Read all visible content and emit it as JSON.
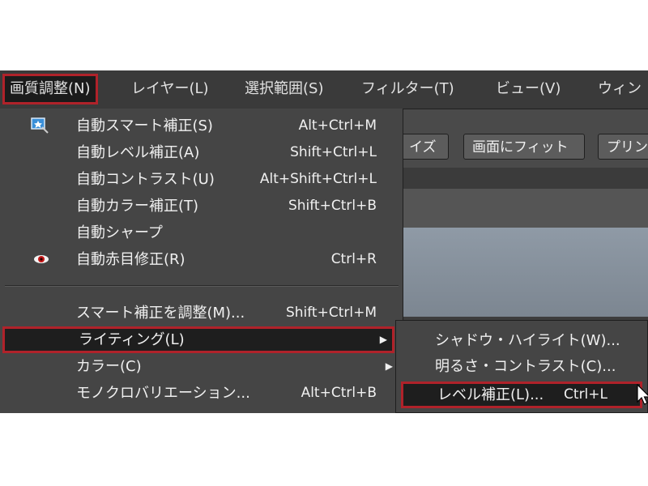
{
  "menubar": {
    "items": [
      {
        "label": "画質調整(N)"
      },
      {
        "label": "レイヤー(L)"
      },
      {
        "label": "選択範囲(S)"
      },
      {
        "label": "フィルター(T)"
      },
      {
        "label": "ビュー(V)"
      },
      {
        "label": "ウィン"
      }
    ]
  },
  "toolbar": {
    "buttons": [
      {
        "label": "イズ"
      },
      {
        "label": "画面にフィット"
      },
      {
        "label": "プリン"
      }
    ]
  },
  "dropdown": {
    "items": [
      {
        "label": "自動スマート補正(S)",
        "shortcut": "Alt+Ctrl+M",
        "icon": "auto-smart-fix-icon"
      },
      {
        "label": "自動レベル補正(A)",
        "shortcut": "Shift+Ctrl+L"
      },
      {
        "label": "自動コントラスト(U)",
        "shortcut": "Alt+Shift+Ctrl+L"
      },
      {
        "label": "自動カラー補正(T)",
        "shortcut": "Shift+Ctrl+B"
      },
      {
        "label": "自動シャープ",
        "shortcut": ""
      },
      {
        "label": "自動赤目修正(R)",
        "shortcut": "Ctrl+R",
        "icon": "red-eye-icon"
      },
      {
        "label": "スマート補正を調整(M)...",
        "shortcut": "Shift+Ctrl+M"
      },
      {
        "label": "ライティング(L)",
        "submenu": true,
        "highlighted": true
      },
      {
        "label": "カラー(C)",
        "submenu": true
      },
      {
        "label": "モノクロバリエーション...",
        "shortcut": "Alt+Ctrl+B"
      }
    ]
  },
  "submenu": {
    "items": [
      {
        "label": "シャドウ・ハイライト(W)...",
        "shortcut": ""
      },
      {
        "label": "明るさ・コントラスト(C)...",
        "shortcut": ""
      },
      {
        "label": "レベル補正(L)...",
        "shortcut": "Ctrl+L",
        "highlighted": true
      }
    ]
  },
  "colors": {
    "highlight_border": "#b0222a",
    "menu_bg": "#454545",
    "menubar_bg": "#3a3a3a",
    "canvas_bg": "#8f9aa6"
  }
}
